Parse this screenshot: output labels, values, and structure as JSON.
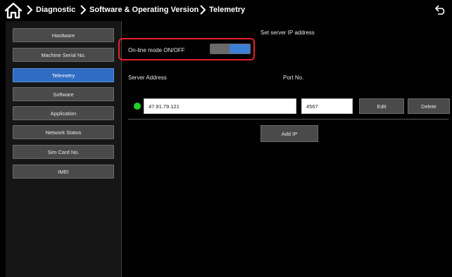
{
  "breadcrumb": {
    "items": [
      "Diagnostic",
      "Software & Operating Version",
      "Telemetry"
    ]
  },
  "sidebar": {
    "items": [
      {
        "label": "Hardware",
        "active": false
      },
      {
        "label": "Machine Serial No.",
        "active": false
      },
      {
        "label": "Telemetry",
        "active": true
      },
      {
        "label": "Software",
        "active": false
      },
      {
        "label": "Application",
        "active": false
      },
      {
        "label": "Network Status",
        "active": false
      },
      {
        "label": "Sim Card No.",
        "active": false
      },
      {
        "label": "IMEI",
        "active": false
      }
    ]
  },
  "main": {
    "section_title": "Set server IP address",
    "online_mode_label": "On-line mode ON/OFF",
    "online_mode_on": true,
    "server_address_label": "Server Address",
    "port_label": "Port No.",
    "server_entry": {
      "status": "connected",
      "status_color": "#22d12a",
      "address": "47.91.79.121",
      "port": "4567",
      "edit_label": "Edit",
      "delete_label": "Delete"
    },
    "add_ip_label": "Add IP"
  },
  "colors": {
    "accent": "#2f6cc2",
    "highlight": "#e8202a"
  },
  "icons": {
    "home": "home-icon",
    "crumb_separator": "chevron-right-icon",
    "back": "back-arrow-icon"
  }
}
